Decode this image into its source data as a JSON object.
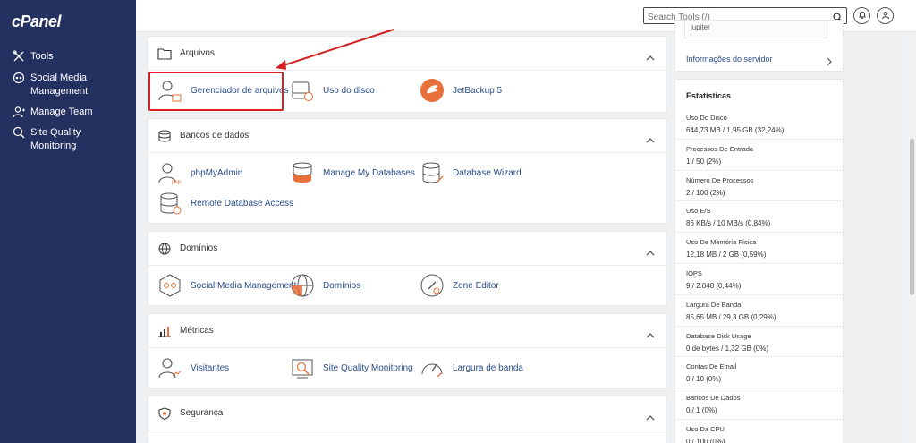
{
  "brand": "cPanel",
  "sidebar": {
    "items": [
      {
        "label": "Tools",
        "icon": "tools-icon"
      },
      {
        "label": "Social Media Management",
        "icon": "social-icon"
      },
      {
        "label": "Manage Team",
        "icon": "team-icon"
      },
      {
        "label": "Site Quality Monitoring",
        "icon": "quality-icon"
      }
    ]
  },
  "search": {
    "placeholder": "Search Tools (/)"
  },
  "sections": [
    {
      "title": "Arquivos",
      "items": [
        "Gerenciador de arquivos",
        "Uso do disco",
        "JetBackup 5"
      ]
    },
    {
      "title": "Bancos de dados",
      "items": [
        "phpMyAdmin",
        "Manage My Databases",
        "Database Wizard",
        "Remote Database Access"
      ]
    },
    {
      "title": "Domínios",
      "items": [
        "Social Media Management",
        "Domínios",
        "Zone Editor"
      ]
    },
    {
      "title": "Métricas",
      "items": [
        "Visitantes",
        "Site Quality Monitoring",
        "Largura de banda"
      ]
    },
    {
      "title": "Segurança",
      "items": []
    }
  ],
  "server_info": {
    "theme_value": "jupiter",
    "link_label": "Informações do servidor"
  },
  "stats": {
    "title": "Estatísticas",
    "items": [
      {
        "label": "Uso Do Disco",
        "value": "644,73 MB / 1,95 GB  (32,24%)"
      },
      {
        "label": "Processos De Entrada",
        "value": "1 / 50  (2%)"
      },
      {
        "label": "Número De Processos",
        "value": "2 / 100  (2%)"
      },
      {
        "label": "Uso E/S",
        "value": "86 KB/s / 10 MB/s  (0,84%)"
      },
      {
        "label": "Uso De Memória Física",
        "value": "12,18 MB / 2 GB  (0,59%)"
      },
      {
        "label": "IOPS",
        "value": "9 / 2.048  (0,44%)"
      },
      {
        "label": "Largura De Banda",
        "value": "85,65 MB / 29,3 GB  (0,29%)"
      },
      {
        "label": "Database Disk Usage",
        "value": "0 de bytes / 1,32 GB  (0%)"
      },
      {
        "label": "Contas De Email",
        "value": "0 / 10  (0%)"
      },
      {
        "label": "Bancos De Dados",
        "value": "0 / 1  (0%)"
      },
      {
        "label": "Uso Da CPU",
        "value": "0 / 100  (0%)"
      }
    ]
  },
  "colors": {
    "sidebar": "#233060",
    "link": "#2b4d8a",
    "accent": "#e8703a",
    "highlight": "#d42020"
  }
}
